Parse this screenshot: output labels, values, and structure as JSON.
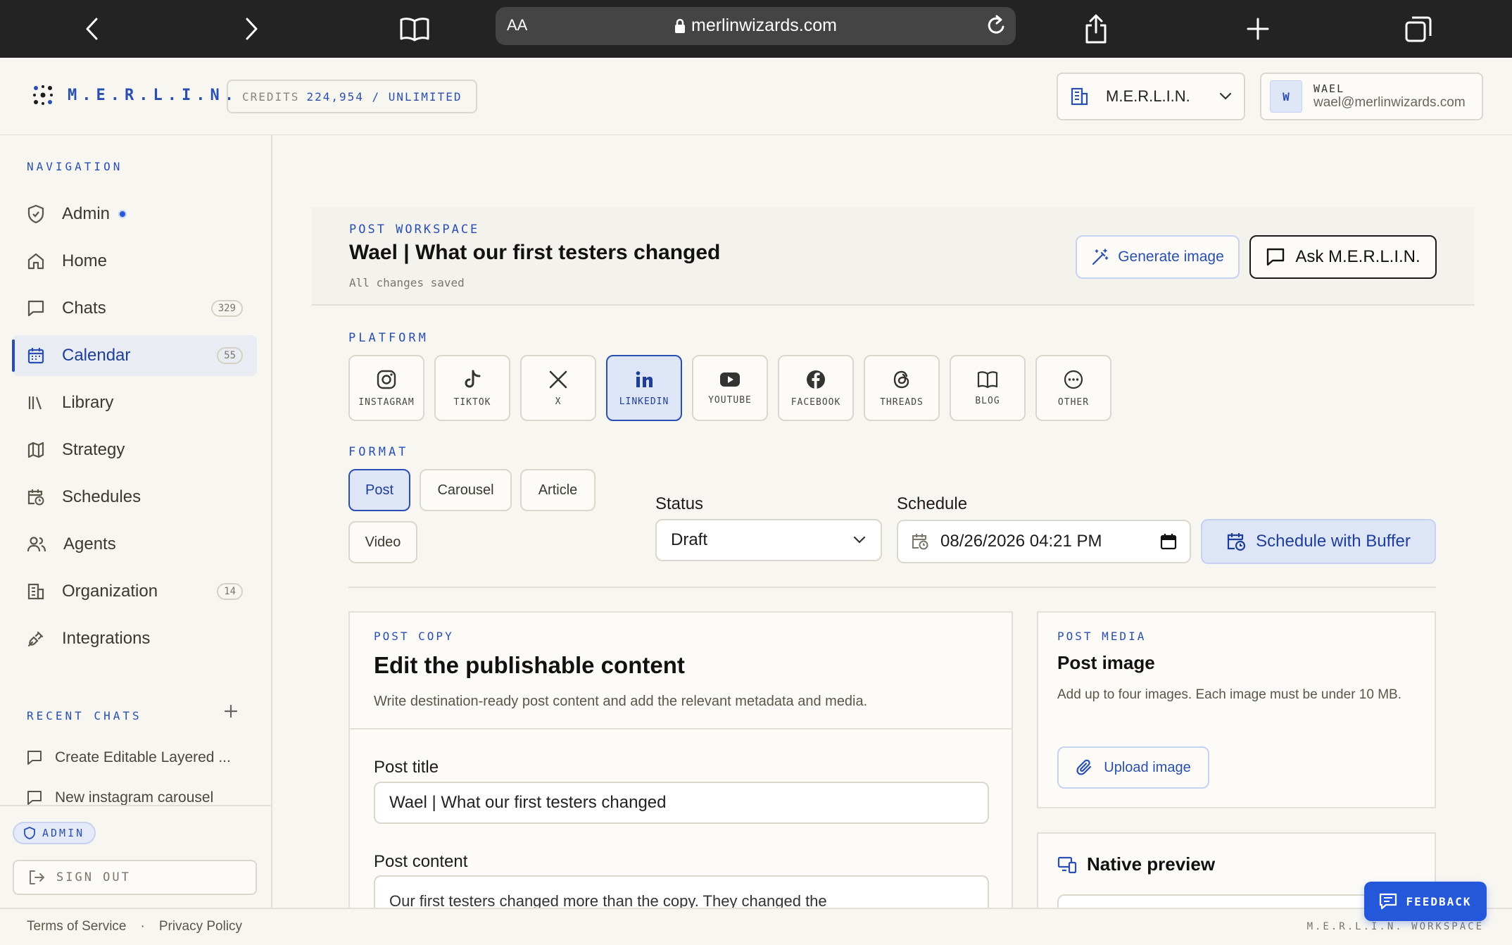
{
  "browser": {
    "aa_label": "AA",
    "url": "merlinwizards.com"
  },
  "header": {
    "logo_text": "M.E.R.L.I.N.",
    "credits_label": "CREDITS",
    "credits_value": "224,954 / UNLIMITED",
    "org_name": "M.E.R.L.I.N.",
    "user_initial": "W",
    "user_name": "WAEL",
    "user_email": "wael@merlinwizards.com"
  },
  "sidebar": {
    "nav_label": "NAVIGATION",
    "items": [
      {
        "label": "Admin",
        "icon": "shield-icon"
      },
      {
        "label": "Home",
        "icon": "home-icon"
      },
      {
        "label": "Chats",
        "icon": "chat-icon",
        "badge": "329"
      },
      {
        "label": "Calendar",
        "icon": "calendar-icon",
        "badge": "55",
        "active": true
      },
      {
        "label": "Library",
        "icon": "library-icon"
      },
      {
        "label": "Strategy",
        "icon": "map-icon"
      },
      {
        "label": "Schedules",
        "icon": "calendar-clock-icon"
      },
      {
        "label": "Agents",
        "icon": "users-icon"
      },
      {
        "label": "Organization",
        "icon": "building-icon",
        "badge": "14"
      },
      {
        "label": "Integrations",
        "icon": "plug-icon"
      }
    ],
    "recent_label": "RECENT CHATS",
    "recent_chats": [
      {
        "label": "Create Editable Layered ..."
      },
      {
        "label": "New instagram carousel"
      }
    ],
    "admin_badge": "ADMIN",
    "sign_out": "SIGN OUT"
  },
  "workspace": {
    "eyebrow": "POST WORKSPACE",
    "title": "Wael | What our first testers changed",
    "saved": "All changes saved",
    "generate_image": "Generate image",
    "ask_merlin": "Ask M.E.R.L.I.N."
  },
  "platform": {
    "label": "PLATFORM",
    "options": [
      {
        "label": "INSTAGRAM",
        "icon": "instagram-icon"
      },
      {
        "label": "TIKTOK",
        "icon": "tiktok-icon"
      },
      {
        "label": "X",
        "icon": "x-icon"
      },
      {
        "label": "LINKEDIN",
        "icon": "linkedin-icon",
        "active": true
      },
      {
        "label": "YOUTUBE",
        "icon": "youtube-icon"
      },
      {
        "label": "FACEBOOK",
        "icon": "facebook-icon"
      },
      {
        "label": "THREADS",
        "icon": "threads-icon"
      },
      {
        "label": "BLOG",
        "icon": "book-icon"
      },
      {
        "label": "OTHER",
        "icon": "more-icon"
      }
    ]
  },
  "format": {
    "label": "FORMAT",
    "options": [
      "Post",
      "Carousel",
      "Article",
      "Video"
    ],
    "selected": "Post"
  },
  "status": {
    "label": "Status",
    "value": "Draft"
  },
  "schedule": {
    "label": "Schedule",
    "value": "08/26/2026 04:21 PM",
    "buffer_button": "Schedule with Buffer"
  },
  "post_copy": {
    "eyebrow": "POST COPY",
    "title": "Edit the publishable content",
    "description": "Write destination-ready post content and add the relevant metadata and media.",
    "title_label": "Post title",
    "title_value": "Wael | What our first testers changed",
    "content_label": "Post content",
    "content_value": "Our first testers changed more than the copy. They changed the"
  },
  "post_media": {
    "eyebrow": "POST MEDIA",
    "title": "Post image",
    "description": "Add up to four images. Each image must be under 10 MB.",
    "upload_button": "Upload image"
  },
  "preview": {
    "title": "Native preview"
  },
  "footer": {
    "terms": "Terms of Service",
    "separator": "·",
    "privacy": "Privacy Policy",
    "brand": "M.E.R.L.I.N. WORKSPACE"
  },
  "feedback": "FEEDBACK",
  "colors": {
    "accent": "#2a4fb0",
    "background": "#f8f6f1",
    "chrome": "#232323"
  }
}
